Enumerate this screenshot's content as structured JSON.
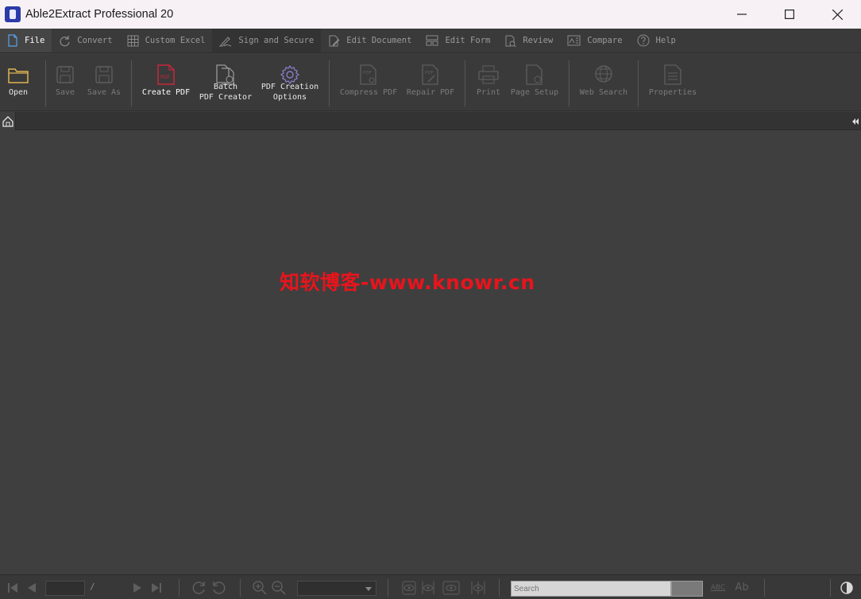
{
  "window": {
    "title": "Able2Extract Professional 20"
  },
  "menu": {
    "tabs": [
      {
        "label": "File",
        "icon": "file-icon"
      },
      {
        "label": "Convert",
        "icon": "refresh-icon"
      },
      {
        "label": "Custom Excel",
        "icon": "grid-icon"
      },
      {
        "label": "Sign and Secure",
        "icon": "signature-icon"
      },
      {
        "label": "Edit Document",
        "icon": "edit-document-icon"
      },
      {
        "label": "Edit Form",
        "icon": "form-icon"
      },
      {
        "label": "Review",
        "icon": "review-icon"
      },
      {
        "label": "Compare",
        "icon": "compare-icon"
      },
      {
        "label": "Help",
        "icon": "help-icon"
      }
    ]
  },
  "ribbon": {
    "open": "Open",
    "save": "Save",
    "save_as": "Save As",
    "create_pdf": "Create PDF",
    "batch_pdf_creator": "Batch\nPDF Creator",
    "pdf_creation_options": "PDF Creation\nOptions",
    "compress_pdf": "Compress PDF",
    "repair_pdf": "Repair PDF",
    "print": "Print",
    "page_setup": "Page Setup",
    "web_search": "Web Search",
    "properties": "Properties"
  },
  "watermark": {
    "text": "知软博客-www.knowr.cn"
  },
  "statusbar": {
    "page_separator": "/",
    "search_placeholder": "Search",
    "spellcheck_label": "ABC",
    "font_label": "Ab"
  },
  "colors": {
    "accent": "#5aa0e6",
    "watermark": "#e8141c",
    "create_pdf_icon": "#c7273a",
    "options_icon": "#8a7cc8",
    "folder_icon": "#e0b451"
  }
}
